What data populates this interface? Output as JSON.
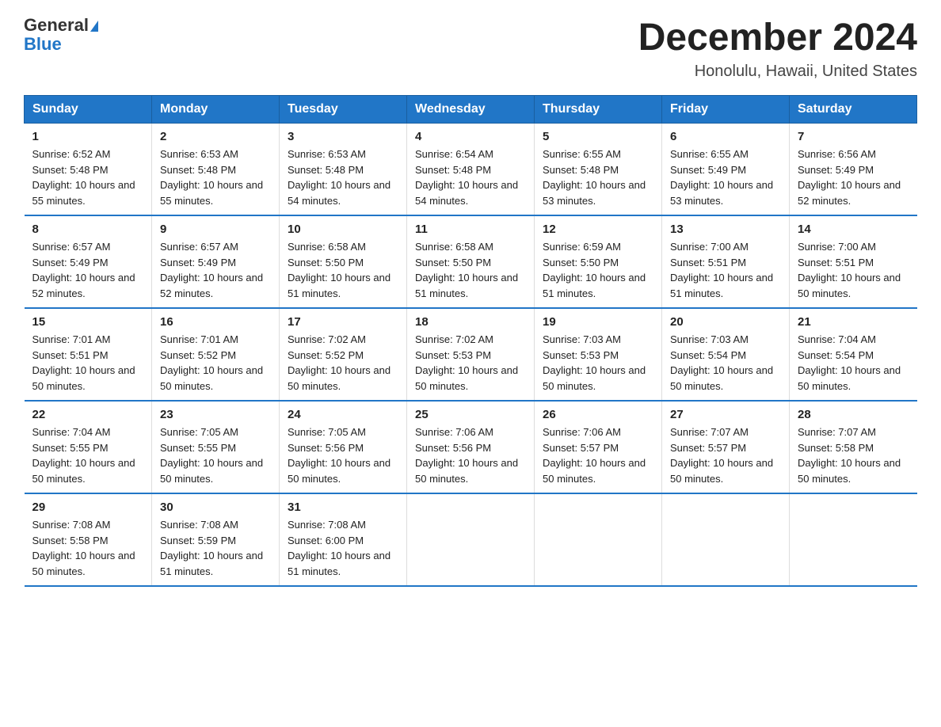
{
  "header": {
    "logo_general": "General",
    "logo_blue": "Blue",
    "title": "December 2024",
    "subtitle": "Honolulu, Hawaii, United States"
  },
  "weekdays": [
    "Sunday",
    "Monday",
    "Tuesday",
    "Wednesday",
    "Thursday",
    "Friday",
    "Saturday"
  ],
  "weeks": [
    [
      {
        "day": "1",
        "sunrise": "6:52 AM",
        "sunset": "5:48 PM",
        "daylight": "10 hours and 55 minutes."
      },
      {
        "day": "2",
        "sunrise": "6:53 AM",
        "sunset": "5:48 PM",
        "daylight": "10 hours and 55 minutes."
      },
      {
        "day": "3",
        "sunrise": "6:53 AM",
        "sunset": "5:48 PM",
        "daylight": "10 hours and 54 minutes."
      },
      {
        "day": "4",
        "sunrise": "6:54 AM",
        "sunset": "5:48 PM",
        "daylight": "10 hours and 54 minutes."
      },
      {
        "day": "5",
        "sunrise": "6:55 AM",
        "sunset": "5:48 PM",
        "daylight": "10 hours and 53 minutes."
      },
      {
        "day": "6",
        "sunrise": "6:55 AM",
        "sunset": "5:49 PM",
        "daylight": "10 hours and 53 minutes."
      },
      {
        "day": "7",
        "sunrise": "6:56 AM",
        "sunset": "5:49 PM",
        "daylight": "10 hours and 52 minutes."
      }
    ],
    [
      {
        "day": "8",
        "sunrise": "6:57 AM",
        "sunset": "5:49 PM",
        "daylight": "10 hours and 52 minutes."
      },
      {
        "day": "9",
        "sunrise": "6:57 AM",
        "sunset": "5:49 PM",
        "daylight": "10 hours and 52 minutes."
      },
      {
        "day": "10",
        "sunrise": "6:58 AM",
        "sunset": "5:50 PM",
        "daylight": "10 hours and 51 minutes."
      },
      {
        "day": "11",
        "sunrise": "6:58 AM",
        "sunset": "5:50 PM",
        "daylight": "10 hours and 51 minutes."
      },
      {
        "day": "12",
        "sunrise": "6:59 AM",
        "sunset": "5:50 PM",
        "daylight": "10 hours and 51 minutes."
      },
      {
        "day": "13",
        "sunrise": "7:00 AM",
        "sunset": "5:51 PM",
        "daylight": "10 hours and 51 minutes."
      },
      {
        "day": "14",
        "sunrise": "7:00 AM",
        "sunset": "5:51 PM",
        "daylight": "10 hours and 50 minutes."
      }
    ],
    [
      {
        "day": "15",
        "sunrise": "7:01 AM",
        "sunset": "5:51 PM",
        "daylight": "10 hours and 50 minutes."
      },
      {
        "day": "16",
        "sunrise": "7:01 AM",
        "sunset": "5:52 PM",
        "daylight": "10 hours and 50 minutes."
      },
      {
        "day": "17",
        "sunrise": "7:02 AM",
        "sunset": "5:52 PM",
        "daylight": "10 hours and 50 minutes."
      },
      {
        "day": "18",
        "sunrise": "7:02 AM",
        "sunset": "5:53 PM",
        "daylight": "10 hours and 50 minutes."
      },
      {
        "day": "19",
        "sunrise": "7:03 AM",
        "sunset": "5:53 PM",
        "daylight": "10 hours and 50 minutes."
      },
      {
        "day": "20",
        "sunrise": "7:03 AM",
        "sunset": "5:54 PM",
        "daylight": "10 hours and 50 minutes."
      },
      {
        "day": "21",
        "sunrise": "7:04 AM",
        "sunset": "5:54 PM",
        "daylight": "10 hours and 50 minutes."
      }
    ],
    [
      {
        "day": "22",
        "sunrise": "7:04 AM",
        "sunset": "5:55 PM",
        "daylight": "10 hours and 50 minutes."
      },
      {
        "day": "23",
        "sunrise": "7:05 AM",
        "sunset": "5:55 PM",
        "daylight": "10 hours and 50 minutes."
      },
      {
        "day": "24",
        "sunrise": "7:05 AM",
        "sunset": "5:56 PM",
        "daylight": "10 hours and 50 minutes."
      },
      {
        "day": "25",
        "sunrise": "7:06 AM",
        "sunset": "5:56 PM",
        "daylight": "10 hours and 50 minutes."
      },
      {
        "day": "26",
        "sunrise": "7:06 AM",
        "sunset": "5:57 PM",
        "daylight": "10 hours and 50 minutes."
      },
      {
        "day": "27",
        "sunrise": "7:07 AM",
        "sunset": "5:57 PM",
        "daylight": "10 hours and 50 minutes."
      },
      {
        "day": "28",
        "sunrise": "7:07 AM",
        "sunset": "5:58 PM",
        "daylight": "10 hours and 50 minutes."
      }
    ],
    [
      {
        "day": "29",
        "sunrise": "7:08 AM",
        "sunset": "5:58 PM",
        "daylight": "10 hours and 50 minutes."
      },
      {
        "day": "30",
        "sunrise": "7:08 AM",
        "sunset": "5:59 PM",
        "daylight": "10 hours and 51 minutes."
      },
      {
        "day": "31",
        "sunrise": "7:08 AM",
        "sunset": "6:00 PM",
        "daylight": "10 hours and 51 minutes."
      },
      null,
      null,
      null,
      null
    ]
  ]
}
